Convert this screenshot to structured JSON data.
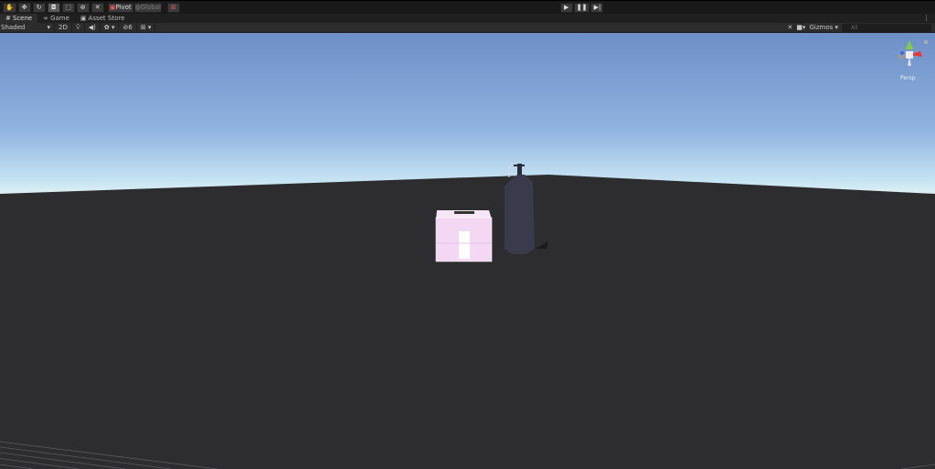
{
  "toolbar": {
    "tools": [
      {
        "name": "hand-tool",
        "glyph": "✋"
      },
      {
        "name": "move-tool",
        "glyph": "✥"
      },
      {
        "name": "rotate-tool",
        "glyph": "↻"
      },
      {
        "name": "scale-tool",
        "glyph": "◘"
      },
      {
        "name": "rect-tool",
        "glyph": "⬚"
      },
      {
        "name": "transform-tool",
        "glyph": "⊛"
      },
      {
        "name": "custom-tool",
        "glyph": "✕"
      }
    ],
    "pivot": "Pivot",
    "global": "Global"
  },
  "tabs": [
    {
      "label": "Scene",
      "icon": "#"
    },
    {
      "label": "Game",
      "icon": "∞"
    },
    {
      "label": "Asset Store",
      "icon": "▣"
    }
  ],
  "scene_toolbar": {
    "shading": "Shaded",
    "mode_2d": "2D",
    "hidden_count": "6",
    "gizmos": "Gizmos",
    "search_placeholder": "All"
  },
  "gizmo": {
    "projection": "Persp",
    "axes": [
      "y",
      "x",
      "z"
    ]
  },
  "colors": {
    "accent": "#5a5a5a",
    "ground": "#2d2d30"
  }
}
